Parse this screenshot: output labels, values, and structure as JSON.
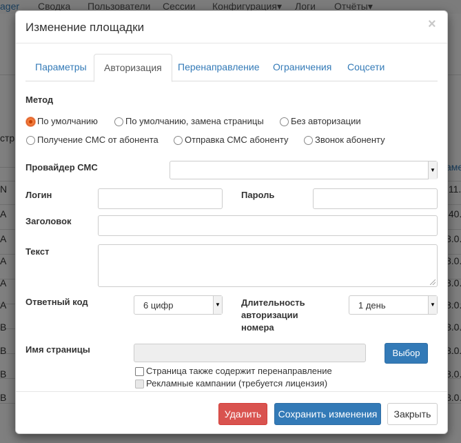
{
  "background": {
    "nav": {
      "brand": "ager",
      "items": [
        "Сводка",
        "Пользователи",
        "Сессии",
        "Конфигурация▾",
        "Логи",
        "Отчёты▾"
      ]
    },
    "left_fragments": [
      "стра",
      "N",
      "A",
      "A",
      "A",
      "A",
      "A",
      "B",
      "B",
      "B",
      "B"
    ],
    "right_fragments": [
      "амет",
      ".11.",
      ".40.",
      "8.0.",
      "8.0.",
      "8.0.",
      "8.0.",
      "8.0.",
      "8.0.",
      "8.0.",
      "8.0."
    ]
  },
  "modal": {
    "title": "Изменение площадки",
    "close_symbol": "×",
    "tabs": [
      "Параметры",
      "Авторизация",
      "Перенаправление",
      "Ограничения",
      "Соцсети"
    ],
    "active_tab": "Авторизация",
    "method": {
      "label": "Метод",
      "options": [
        {
          "label": "По умолчанию",
          "checked": true
        },
        {
          "label": "По умолчанию, замена страницы",
          "checked": false
        },
        {
          "label": "Без авторизации",
          "checked": false
        },
        {
          "label": "Получение СМС от абонента",
          "checked": false
        },
        {
          "label": "Отправка СМС абоненту",
          "checked": false
        },
        {
          "label": "Звонок абоненту",
          "checked": false
        }
      ]
    },
    "sms_provider": {
      "label": "Провайдер СМС",
      "value": ""
    },
    "login": {
      "label": "Логин",
      "value": ""
    },
    "password": {
      "label": "Пароль",
      "value": ""
    },
    "header_field": {
      "label": "Заголовок",
      "value": ""
    },
    "text_field": {
      "label": "Текст",
      "value": ""
    },
    "response_code": {
      "label": "Ответный код",
      "value": "6 цифр"
    },
    "auth_duration": {
      "label_line1": "Длительность",
      "label_line2": "авторизации",
      "label_line3": "номера",
      "value": "1 день"
    },
    "page_name": {
      "label": "Имя страницы",
      "value": "",
      "select_button": "Выбор"
    },
    "checkboxes": [
      {
        "label": "Страница также содержит перенаправление",
        "checked": false,
        "disabled": false
      },
      {
        "label": "Рекламные кампании (требуется лицензия)",
        "checked": false,
        "disabled": true
      }
    ],
    "footer": {
      "delete": "Удалить",
      "save": "Сохранить изменения",
      "close": "Закрыть"
    }
  },
  "colors": {
    "primary": "#337ab7",
    "danger": "#d9534f",
    "radio_checked": "#f07a3a"
  }
}
